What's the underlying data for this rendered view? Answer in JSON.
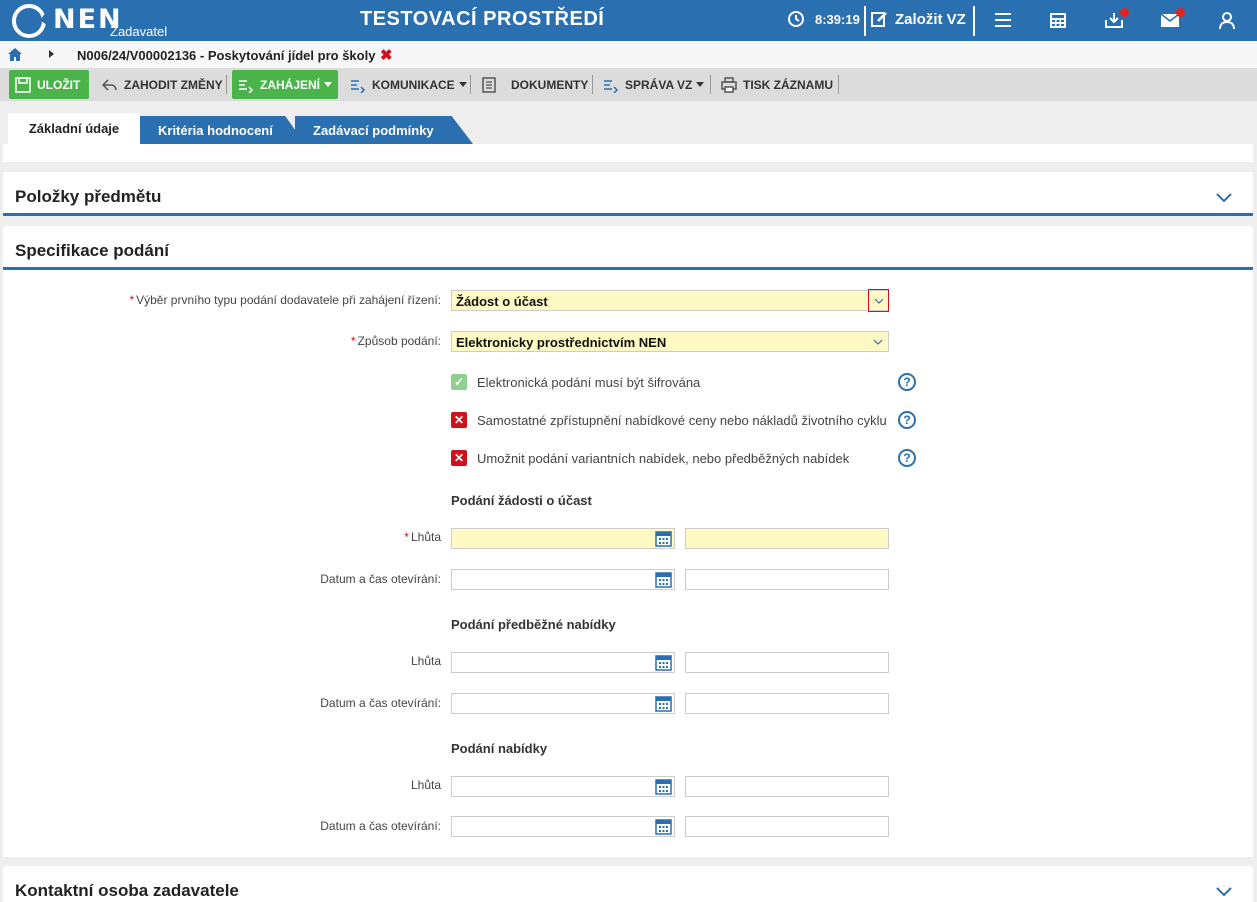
{
  "header": {
    "brand": "NEN",
    "brand_sub": "Zadavatel",
    "env_title": "TESTOVACÍ PROSTŘEDÍ",
    "time": "8:39:19",
    "new_vz": "Založit VZ",
    "icons": [
      "clock-icon",
      "edit-icon",
      "menu-icon",
      "calculator-icon",
      "inbox-icon",
      "mail-icon",
      "user-icon"
    ],
    "brand_color": "#2a6fb0"
  },
  "breadcrumb": {
    "text": "N006/24/V00002136 - Poskytování jídel pro školy",
    "close": "✖"
  },
  "toolbar": {
    "save": "ULOŽIT",
    "discard": "ZAHODIT ZMĚNY",
    "start": "ZAHÁJENÍ",
    "communication": "KOMUNIKACE",
    "documents": "DOKUMENTY",
    "manage": "SPRÁVA VZ",
    "print": "TISK ZÁZNAMU"
  },
  "tabs": [
    "Základní údaje",
    "Kritéria hodnocení",
    "Zadávací podmínky"
  ],
  "sections": {
    "items": "Položky předmětu",
    "spec": "Specifikace podání",
    "contact": "Kontaktní osoba zadavatele"
  },
  "form": {
    "first_type_label": "Výběr prvního typu podání dodavatele při zahájení řízení:",
    "first_type_value": "Žádost o účast",
    "method_label": "Způsob podání:",
    "method_value": "Elektronicky prostřednictvím NEN",
    "req_mark": "*",
    "checkboxes": [
      {
        "label": "Elektronická podání musí být šifrována",
        "checked": true,
        "mark": "✓"
      },
      {
        "label": "Samostatné zpřístupnění nabídkové ceny nebo nákladů životního cyklu",
        "checked": false,
        "mark": "✕"
      },
      {
        "label": "Umožnit podání variantních nabídek, nebo předběžných nabídek",
        "checked": false,
        "mark": "✕"
      }
    ],
    "help": "?",
    "groups": [
      {
        "title": "Podání žádosti o účast",
        "deadline": "Lhůta",
        "opening": "Datum a čas otevírání:"
      },
      {
        "title": "Podání předběžné nabídky",
        "deadline": "Lhůta",
        "opening": "Datum a čas otevírání:"
      },
      {
        "title": "Podání nabídky",
        "deadline": "Lhůta",
        "opening": "Datum a čas otevírání:"
      }
    ]
  }
}
